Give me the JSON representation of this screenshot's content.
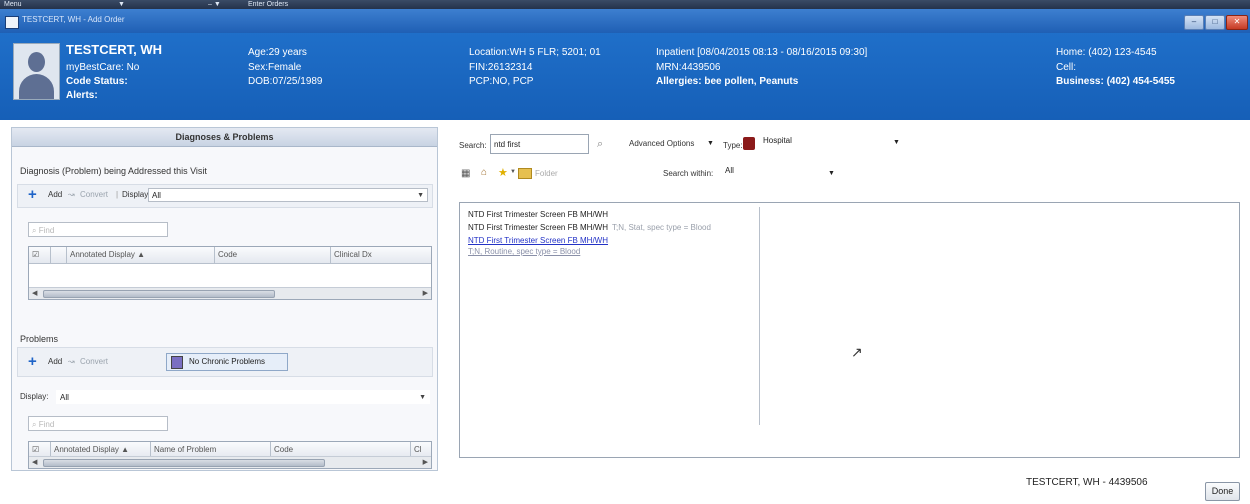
{
  "taskbar": {
    "items": [
      "Menu",
      "▼",
      "– ▼",
      "Enter Orders"
    ]
  },
  "window": {
    "title": "TESTCERT, WH - Add Order",
    "buttons": {
      "minimize": "–",
      "maximize": "□",
      "close": "✕"
    }
  },
  "patient": {
    "name": "TESTCERT, WH",
    "mybestcare": "myBestCare: No",
    "code_status": "Code Status:",
    "alerts": "Alerts:",
    "age": "Age:29 years",
    "sex": "Sex:Female",
    "dob": "DOB:07/25/1989",
    "location": "Location:WH 5 FLR; 5201; 01",
    "fin": "FIN:26132314",
    "pcp": "PCP:NO, PCP",
    "inpatient": "Inpatient [08/04/2015 08:13 - 08/16/2015 09:30]",
    "mrn": "MRN:4439506",
    "allergies": "Allergies: bee pollen, Peanuts",
    "home": "Home: (402) 123-4545",
    "cell": "Cell:",
    "business": "Business: (402) 454-5455"
  },
  "left_panel": {
    "header": "Diagnoses & Problems",
    "diagnosis_section": "Diagnosis (Problem) being Addressed this Visit",
    "add": "Add",
    "convert": "Convert",
    "display_label": "Display:",
    "display_value": "All",
    "search_placeholder": "Find",
    "diag_columns": [
      "Annotated Display ▲",
      "Code",
      "Clinical Dx"
    ],
    "problems_label": "Problems",
    "no_chronic": "No Chronic Problems",
    "prob_columns": [
      "Annotated Display ▲",
      "Name of Problem",
      "Code",
      "Cl"
    ]
  },
  "right_panel": {
    "search_label": "Search:",
    "search_value": "ntd first",
    "advanced_options": "Advanced Options",
    "type_label": "Type:",
    "type_value": "Hospital",
    "folder": "Folder",
    "search_within_label": "Search within:",
    "search_within_value": "All",
    "results": [
      {
        "text": "NTD First Trimester Screen FB MH/WH",
        "sub": ""
      },
      {
        "text": "NTD First Trimester Screen FB MH/WH",
        "sub": "T;N, Stat, spec type = Blood"
      },
      {
        "text": "NTD First Trimester Screen FB MH/WH",
        "sub": ""
      },
      {
        "text": "T;N, Routine, spec type = Blood",
        "sub": ""
      }
    ]
  },
  "footer": {
    "patient_id": "TESTCERT, WH - 4439506",
    "done": "Done"
  }
}
